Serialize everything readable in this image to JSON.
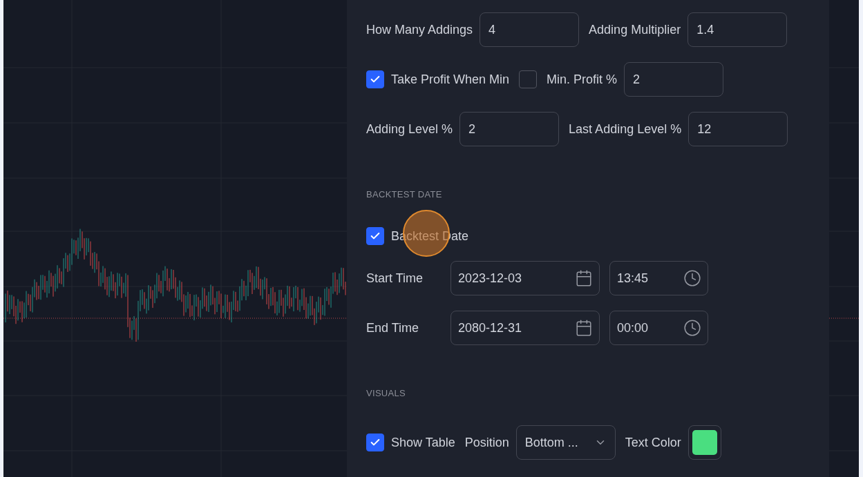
{
  "sections": [
    {
      "rows": [
        [
          {
            "kind": "input",
            "label": "How Many Addings",
            "value": "4"
          },
          {
            "kind": "input",
            "label": "Adding Multiplier",
            "value": "1.4"
          }
        ],
        [
          {
            "kind": "checkbox",
            "label": "Take Profit When Min",
            "checked": true
          },
          {
            "kind": "checkbox",
            "checked": false
          },
          {
            "kind": "input",
            "label": "Min. Profit %",
            "value": "2"
          }
        ],
        [
          {
            "kind": "input",
            "label": "Adding Level %",
            "value": "2"
          },
          {
            "kind": "input",
            "label": "Last Adding Level %",
            "value": "12"
          }
        ]
      ]
    },
    {
      "heading": "BACKTEST DATE",
      "rows": [
        [
          {
            "kind": "checkbox",
            "label": "Backtest Date",
            "checked": true
          }
        ],
        [
          {
            "kind": "datetime",
            "label": "Start Time",
            "date": "2023-12-03",
            "time": "13:45"
          }
        ],
        [
          {
            "kind": "datetime",
            "label": "End Time",
            "date": "2080-12-31",
            "time": "00:00"
          }
        ]
      ]
    },
    {
      "heading": "VISUALS",
      "rows": [
        [
          {
            "kind": "checkbox",
            "label": "Show Table",
            "checked": true
          },
          {
            "kind": "select",
            "label": "Position",
            "value": "Bottom ..."
          },
          {
            "kind": "color",
            "label": "Text Color",
            "color": "#4ade80"
          }
        ]
      ]
    }
  ]
}
